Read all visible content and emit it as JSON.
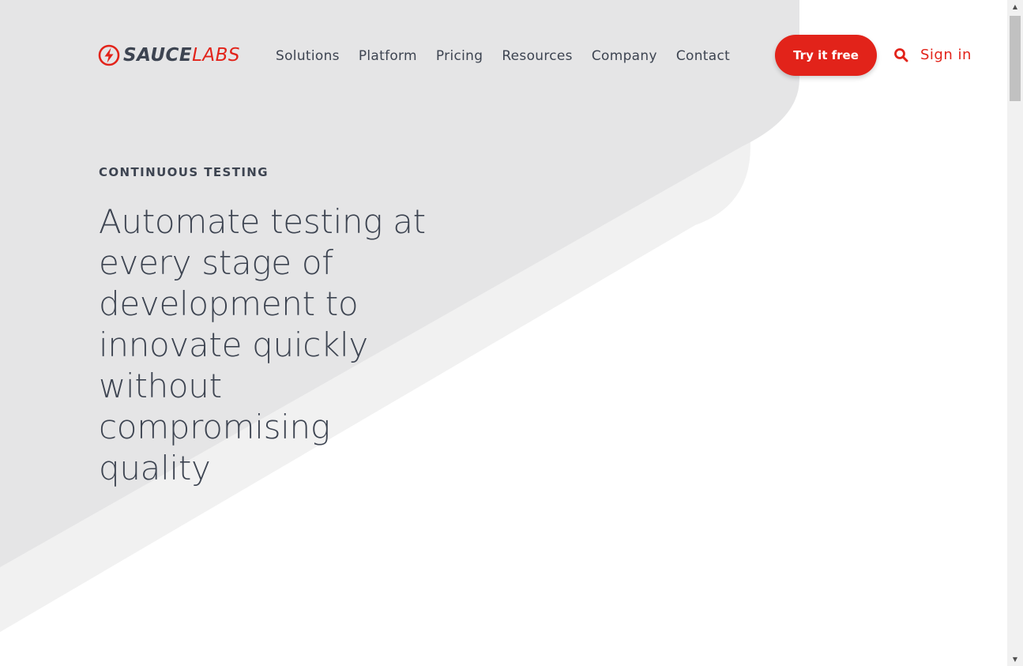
{
  "header": {
    "logo": {
      "sauce": "SAUCE",
      "labs": "LABS",
      "mark_icon": "lightning-bolt-icon"
    },
    "nav": [
      "Solutions",
      "Platform",
      "Pricing",
      "Resources",
      "Company",
      "Contact"
    ],
    "cta_label": "Try it free",
    "search_icon": "search-icon",
    "signin_label": "Sign in"
  },
  "hero": {
    "eyebrow": "CONTINUOUS TESTING",
    "headline": "Automate testing at every stage of development to innovate quickly without compromising quality"
  },
  "colors": {
    "brand_red": "#e2231a",
    "text_dark": "#3d4451",
    "bg_dark_shape": "#e5e5e6",
    "bg_light_shape": "#f1f1f1",
    "page_bg": "#ffffff"
  }
}
